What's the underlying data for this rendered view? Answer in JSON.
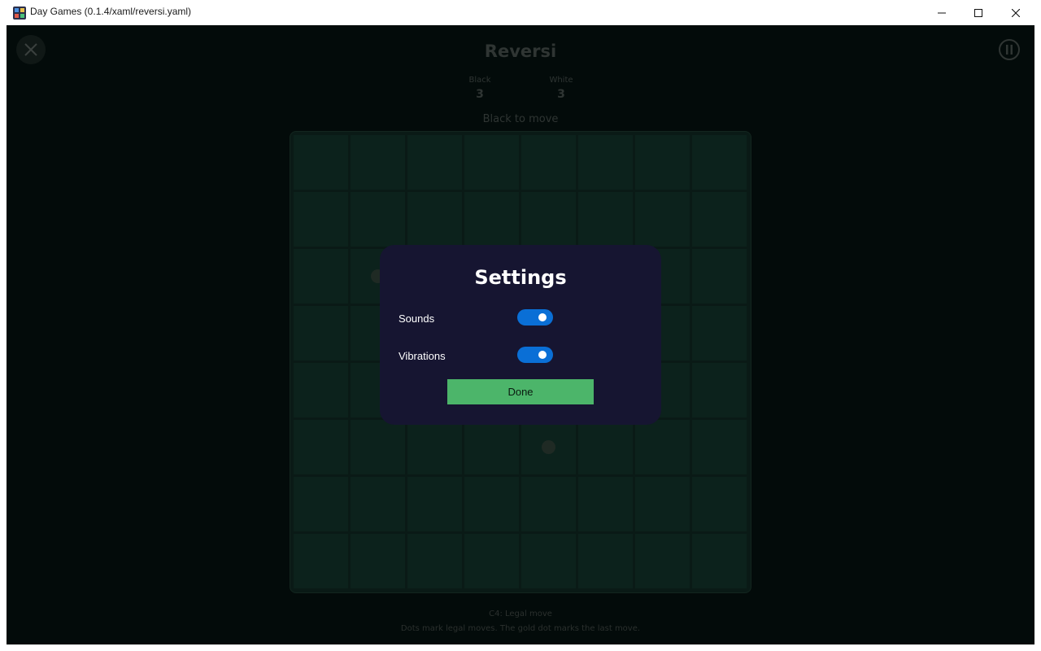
{
  "window": {
    "title": "Day Games (0.1.4/xaml/reversi.yaml)"
  },
  "game": {
    "title": "Reversi",
    "black_label": "Black",
    "black_score": "3",
    "white_label": "White",
    "white_score": "3",
    "turn": "Black to move",
    "status": "C4: Legal move",
    "hint": "Dots mark legal moves. The gold dot marks the last move."
  },
  "settings": {
    "title": "Settings",
    "sounds_label": "Sounds",
    "sounds_on": true,
    "vibrations_label": "Vibrations",
    "vibrations_on": true,
    "done_label": "Done"
  },
  "colors": {
    "background": "#030b0a",
    "board": "#0c221c",
    "dialog": "#161531",
    "toggle_on": "#0a6fd6",
    "done_button": "#4cb56a"
  }
}
